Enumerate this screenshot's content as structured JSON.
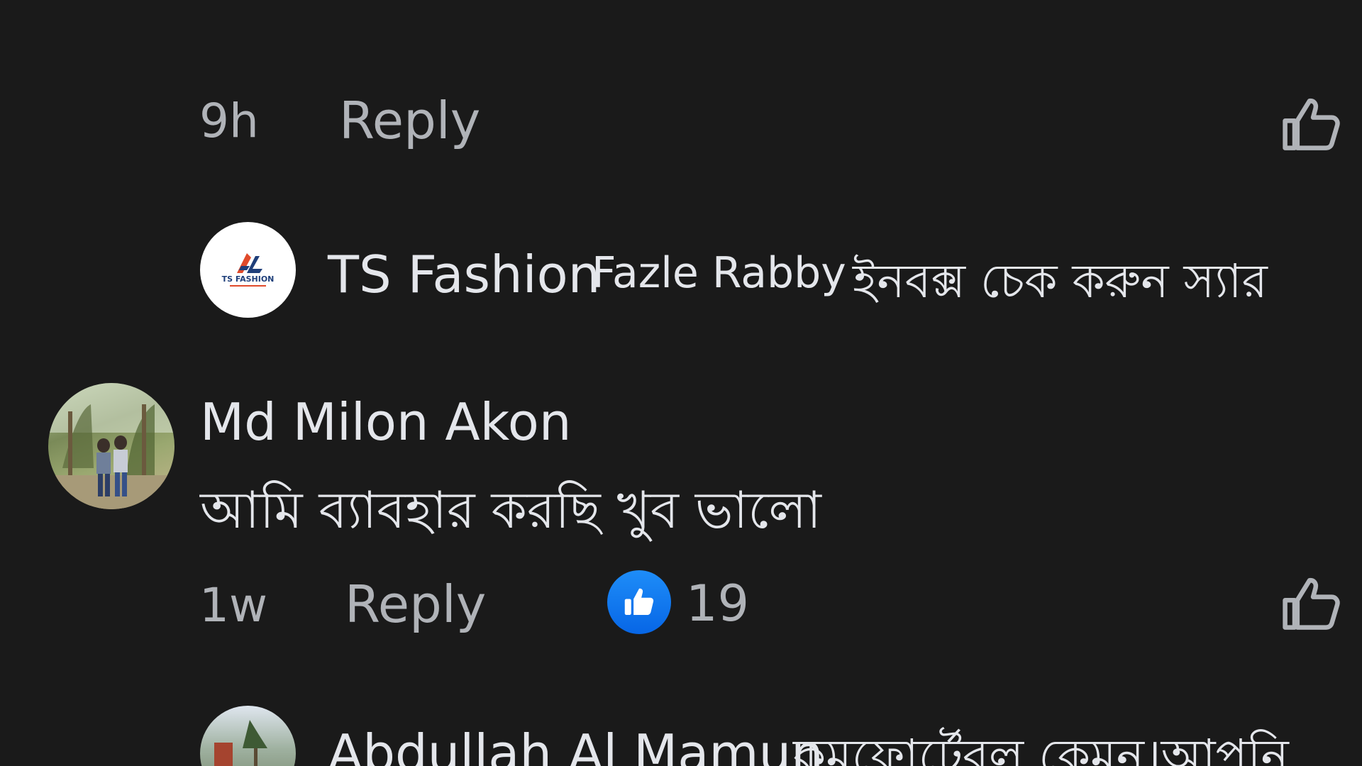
{
  "comments": [
    {
      "time": "9h",
      "reply_label": "Reply"
    },
    {
      "author": "TS Fashion",
      "avatar_text": "TS FASHION",
      "mention": "Fazle Rabby",
      "text": "ইনবক্স চেক করুন স্যার"
    },
    {
      "author": "Md Milon Akon",
      "text": "আমি ব্যাবহার করছি খুব ভালো",
      "time": "1w",
      "reply_label": "Reply",
      "reaction_count": "19",
      "reaction_icon": "like-reaction-icon"
    },
    {
      "author": "Abdullah Al Mamun",
      "text": "কমফোর্টেবল কেমন।আপনি"
    }
  ],
  "colors": {
    "background": "#1a1a1a",
    "text_primary": "#e4e6eb",
    "text_secondary": "#b0b3b8",
    "like_blue": "#0866ff"
  }
}
